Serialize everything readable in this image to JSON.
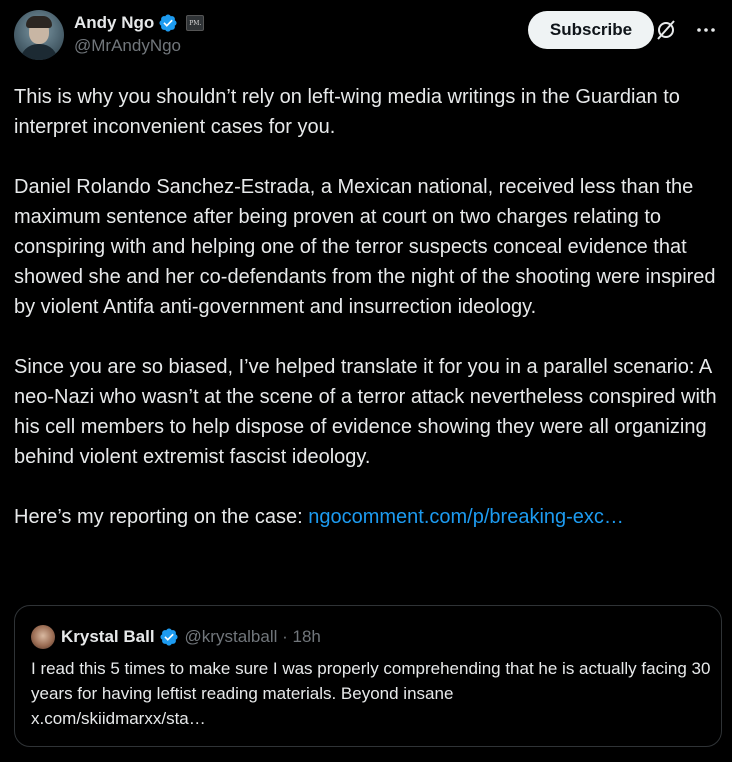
{
  "author": {
    "display_name": "Andy Ngo",
    "handle": "@MrAndyNgo",
    "affiliation_badge": "PM."
  },
  "actions": {
    "subscribe_label": "Subscribe",
    "grok_icon": "grok-icon",
    "more_icon": "more-icon"
  },
  "tweet": {
    "paragraphs": [
      "This is why you shouldn’t rely on left-wing media writings in the Guardian to interpret inconvenient cases for you.",
      "Daniel Rolando Sanchez-Estrada, a Mexican national, received less than the maximum sentence after being proven at court on two charges relating to conspiring with and helping one of the terror suspects conceal evidence that showed she and her co-defendants from the night of the shooting were inspired by violent Antifa anti-government and insurrection ideology.",
      "Since you are so biased, I’ve helped translate it for you in a parallel scenario: A neo-Nazi who wasn’t at the scene of a terror attack nevertheless conspired with his cell members to help dispose of evidence showing they were all organizing behind violent extremist fascist ideology."
    ],
    "reporting_prefix": "Here’s my reporting on the case: ",
    "reporting_link": "ngocomment.com/p/breaking-exc…"
  },
  "quote": {
    "display_name": "Krystal Ball",
    "handle_time": "@krystalball · 18h",
    "text": "I read this 5 times to make sure I was properly comprehending that he is actually facing 30 years for having leftist reading materials.  Beyond insane",
    "link": "x.com/skiidmarxx/sta…"
  },
  "colors": {
    "background": "#000000",
    "text": "#e7e9ea",
    "secondary": "#71767b",
    "link": "#1d9bf0",
    "verified": "#1d9bf0"
  }
}
